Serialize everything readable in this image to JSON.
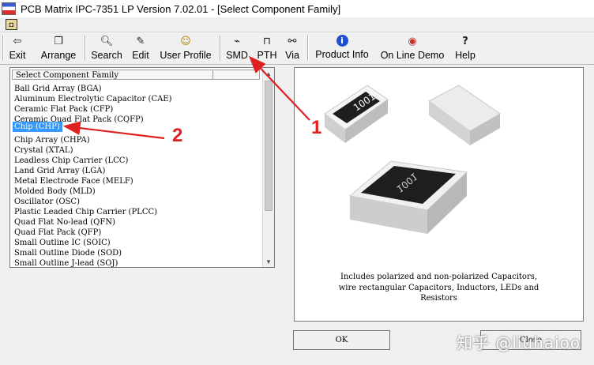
{
  "window": {
    "title": "PCB Matrix IPC-7351 LP Version  7.02.01 - [Select Component Family]",
    "sys_menu_glyph": "◘"
  },
  "toolbar": {
    "buttons": [
      {
        "label": "Exit",
        "icon": "exit-door-icon",
        "glyph": "⇦"
      },
      {
        "label": "Arrange",
        "icon": "arrange-windows-icon",
        "glyph": "❐"
      },
      {
        "label": "Search",
        "icon": "search-icon",
        "glyph": "🔍︎"
      },
      {
        "label": "Edit",
        "icon": "edit-icon",
        "glyph": "✎"
      },
      {
        "label": "User Profile",
        "icon": "user-profile-icon",
        "glyph": "☺"
      },
      {
        "label": "SMD",
        "icon": "smd-icon",
        "glyph": "⌁"
      },
      {
        "label": "PTH",
        "icon": "pth-icon",
        "glyph": "⊓"
      },
      {
        "label": "Via",
        "icon": "via-icon",
        "glyph": "⚯"
      },
      {
        "label": "Product Info",
        "icon": "info-icon",
        "glyph": "i"
      },
      {
        "label": "On Line Demo",
        "icon": "globe-icon",
        "glyph": "◉"
      },
      {
        "label": "Help",
        "icon": "help-icon",
        "glyph": "?"
      }
    ]
  },
  "family_list": {
    "header": "Select Component Family",
    "selected_index": 4,
    "items": [
      "Ball Grid Array (BGA)",
      "Aluminum Electrolytic Capacitor (CAE)",
      "Ceramic Flat Pack (CFP)",
      "Ceramic Quad Flat Pack (CQFP)",
      "Chip (CHP)",
      "Chip Array (CHPA)",
      "Crystal (XTAL)",
      "Leadless Chip Carrier (LCC)",
      "Land Grid Array (LGA)",
      "Metal Electrode Face (MELF)",
      "Molded Body (MLD)",
      "Oscillator (OSC)",
      "Plastic Leaded Chip Carrier (PLCC)",
      "Quad Flat No-lead (QFN)",
      "Quad Flat Pack (QFP)",
      "Small Outline IC (SOIC)",
      "Small Outline Diode (SOD)",
      "Small Outline J-lead (SOJ)"
    ]
  },
  "preview": {
    "chip_marking": "1001",
    "description_lines": [
      "Includes polarized and non-polarized Capacitors,",
      "wire rectangular Capacitors, Inductors, LEDs and",
      "Resistors"
    ]
  },
  "buttons": {
    "ok": "OK",
    "close": "Close"
  },
  "watermark": "知乎 @liuhaioo",
  "annotations": {
    "label_1": "1",
    "label_2": "2",
    "color": "#e02020"
  },
  "colors": {
    "selection": "#3399ff",
    "window_bg": "#f0f0f0"
  }
}
